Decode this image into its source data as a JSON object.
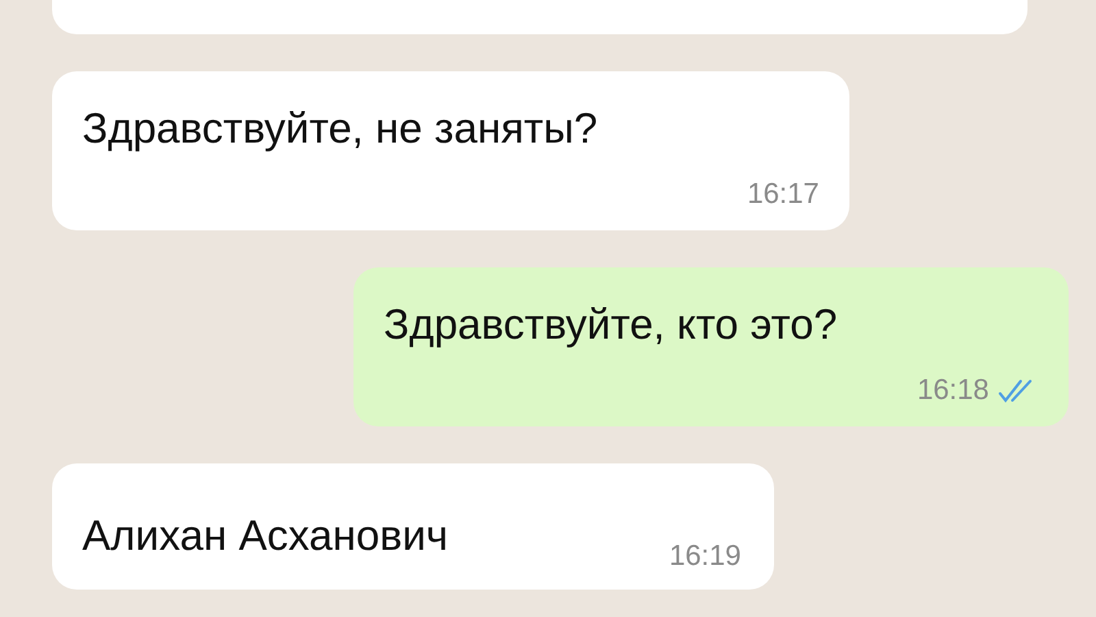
{
  "messages": [
    {
      "kind": "incoming",
      "text": "Здравствуйте, не заняты?",
      "time": "16:17"
    },
    {
      "kind": "outgoing",
      "text": "Здравствуйте, кто это?",
      "time": "16:18",
      "read": true
    },
    {
      "kind": "incoming",
      "text": "Алихан Асханович",
      "time": "16:19"
    }
  ]
}
